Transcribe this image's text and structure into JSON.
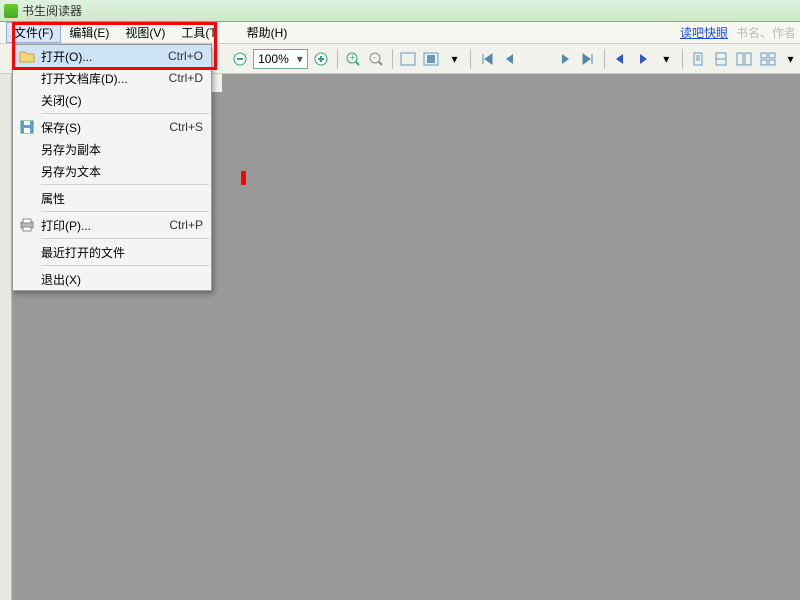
{
  "title": "书生阅读器",
  "menus": {
    "file": "文件(F)",
    "edit": "编辑(E)",
    "view": "视图(V)",
    "tool": "工具(T",
    "help": "帮助(H)"
  },
  "topright": {
    "link": "读吧快眼",
    "search_placeholder": "书名、作者、"
  },
  "zoom": "100%",
  "tab": "▶",
  "dropdown": [
    {
      "icon": "folder",
      "label": "打开(O)...",
      "shortcut": "Ctrl+O",
      "selected": true
    },
    {
      "icon": "",
      "label": "打开文档库(D)...",
      "shortcut": "Ctrl+D"
    },
    {
      "icon": "",
      "label": "关闭(C)",
      "shortcut": ""
    },
    {
      "sep": true
    },
    {
      "icon": "save",
      "label": "保存(S)",
      "shortcut": "Ctrl+S"
    },
    {
      "icon": "",
      "label": "另存为副本",
      "shortcut": ""
    },
    {
      "icon": "",
      "label": "另存为文本",
      "shortcut": ""
    },
    {
      "sep": true
    },
    {
      "icon": "",
      "label": "属性",
      "shortcut": ""
    },
    {
      "sep": true
    },
    {
      "icon": "print",
      "label": "打印(P)...",
      "shortcut": "Ctrl+P"
    },
    {
      "sep": true
    },
    {
      "icon": "",
      "label": "最近打开的文件",
      "shortcut": ""
    },
    {
      "sep": true
    },
    {
      "icon": "",
      "label": "退出(X)",
      "shortcut": ""
    }
  ]
}
